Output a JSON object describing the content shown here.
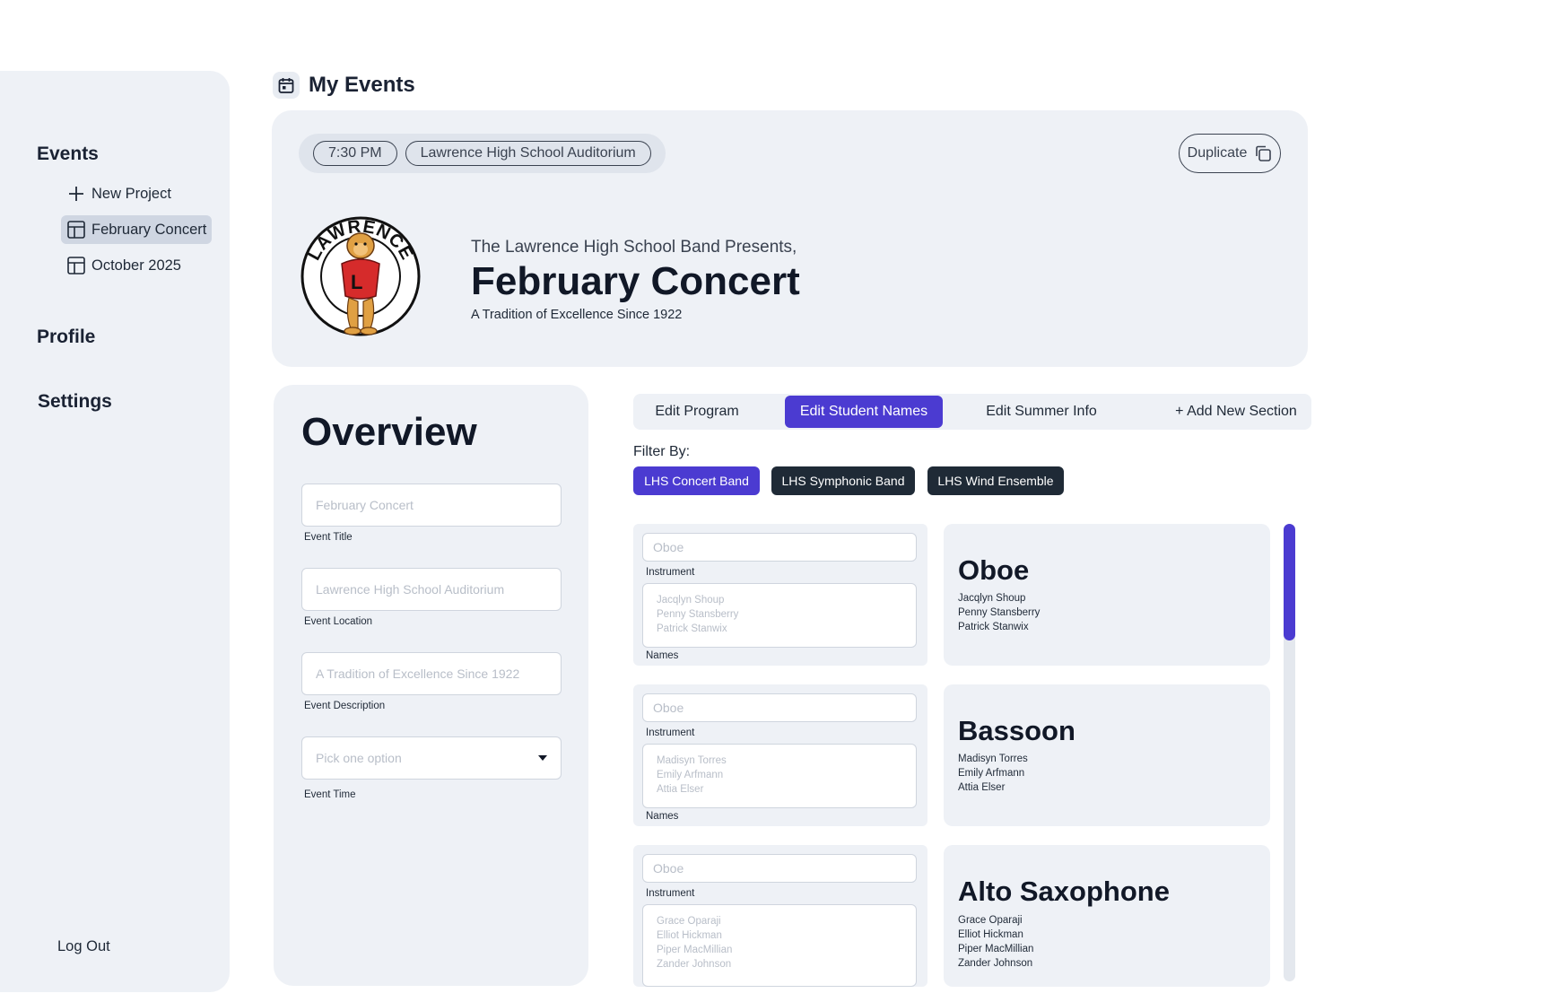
{
  "sidebar": {
    "events_heading": "Events",
    "items": [
      {
        "label": "New Project",
        "icon": "plus-icon"
      },
      {
        "label": "February Concert",
        "icon": "table-icon",
        "active": true
      },
      {
        "label": "October 2025",
        "icon": "table-icon"
      }
    ],
    "profile_heading": "Profile",
    "settings_heading": "Settings",
    "logout_label": "Log Out"
  },
  "header": {
    "title": "My Events",
    "icon": "calendar-icon"
  },
  "hero": {
    "time": "7:30 PM",
    "location": "Lawrence High School Auditorium",
    "duplicate_label": "Duplicate",
    "logo_text": "LAWRENCE",
    "presents": "The Lawrence High School Band Presents,",
    "title": "February Concert",
    "description": "A Tradition of Excellence Since 1922"
  },
  "overview": {
    "title": "Overview",
    "fields": [
      {
        "placeholder": "February Concert",
        "label": "Event Title"
      },
      {
        "placeholder": "Lawrence High School Auditorium",
        "label": "Event Location"
      },
      {
        "placeholder": "A Tradition of Excellence Since 1922",
        "label": "Event Description"
      },
      {
        "placeholder": "Pick one option",
        "label": "Event Time"
      }
    ]
  },
  "tabs": [
    {
      "label": "Edit Program"
    },
    {
      "label": "Edit Student Names",
      "active": true
    },
    {
      "label": "Edit Summer Info"
    },
    {
      "label": "+ Add New Section"
    }
  ],
  "filter": {
    "label": "Filter By:",
    "chips": [
      {
        "label": "LHS Concert Band",
        "active": true
      },
      {
        "label": "LHS Symphonic Band"
      },
      {
        "label": "LHS Wind Ensemble"
      }
    ]
  },
  "sections": [
    {
      "instrument_placeholder": "Oboe",
      "instrument_label": "Instrument",
      "names_placeholder": [
        "Jacqlyn Shoup",
        "Penny Stansberry",
        "Patrick Stanwix"
      ],
      "names_label": "Names",
      "preview_title": "Oboe",
      "preview_names": [
        "Jacqlyn Shoup",
        "Penny Stansberry",
        "Patrick Stanwix"
      ]
    },
    {
      "instrument_placeholder": "Oboe",
      "instrument_label": "Instrument",
      "names_placeholder": [
        "Madisyn Torres",
        "Emily Arfmann",
        "Attia Elser"
      ],
      "names_label": "Names",
      "preview_title": "Bassoon",
      "preview_names": [
        "Madisyn Torres",
        "Emily Arfmann",
        "Attia Elser"
      ]
    },
    {
      "instrument_placeholder": "Oboe",
      "instrument_label": "Instrument",
      "names_placeholder": [
        "Grace Oparaji",
        "Elliot Hickman",
        "Piper MacMillian",
        "Zander Johnson"
      ],
      "names_label": "Names",
      "preview_title": "Alto Saxophone",
      "preview_names": [
        "Grace Oparaji",
        "Elliot Hickman",
        "Piper MacMillian",
        "Zander Johnson"
      ]
    }
  ],
  "colors": {
    "accent": "#4b3bd1",
    "chip_dark": "#1f2a36",
    "panel_bg": "#eef1f6"
  }
}
